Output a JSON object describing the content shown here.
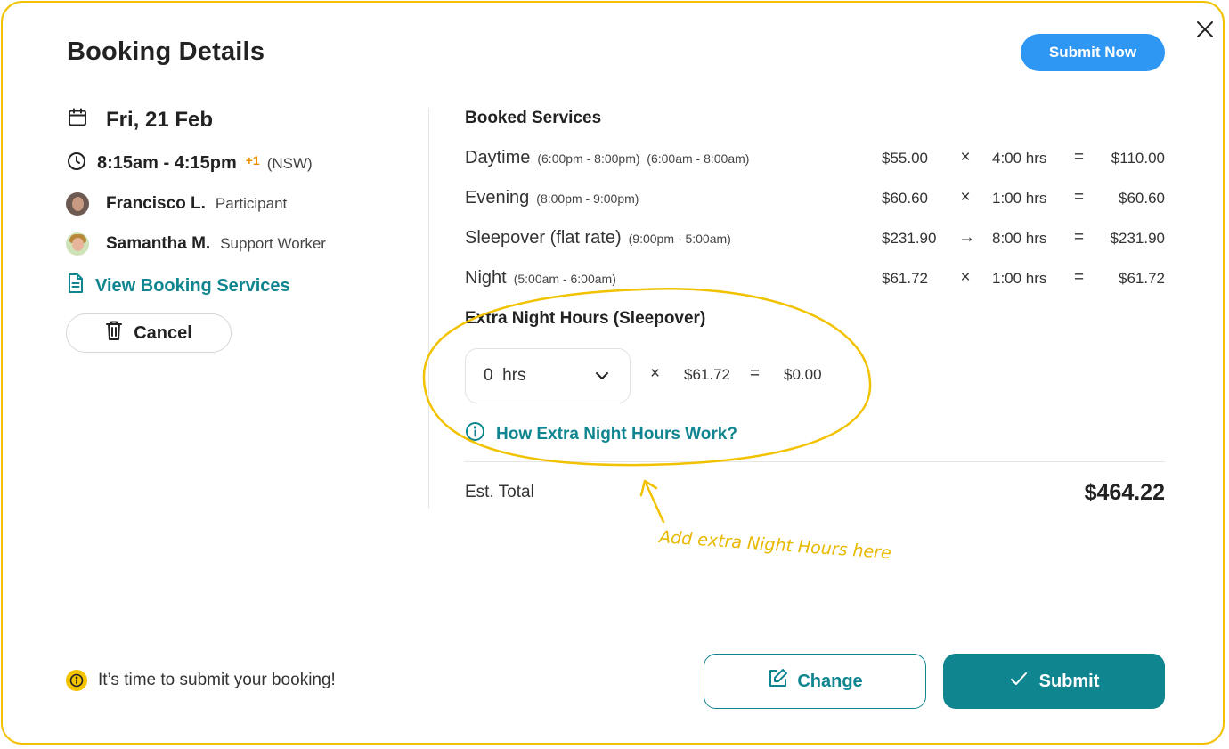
{
  "dialog": {
    "title": "Booking Details",
    "submit_now_label": "Submit Now",
    "close_icon": "close-icon"
  },
  "booking": {
    "date": "Fri, 21 Feb",
    "time": "8:15am - 4:15pm",
    "day_offset": "+1",
    "timezone": "(NSW)",
    "people": [
      {
        "name": "Francisco L.",
        "role": "Participant"
      },
      {
        "name": "Samantha M.",
        "role": "Support Worker"
      }
    ],
    "view_services_label": "View Booking Services",
    "cancel_label": "Cancel"
  },
  "services": {
    "title": "Booked Services",
    "items": [
      {
        "name": "Daytime",
        "ranges": "(6:00pm - 8:00pm)  (6:00am - 8:00am)",
        "rate": "$55.00",
        "op": "×",
        "hours": "4:00 hrs",
        "eq": "=",
        "amount": "$110.00"
      },
      {
        "name": "Evening",
        "ranges": "(8:00pm - 9:00pm)",
        "rate": "$60.60",
        "op": "×",
        "hours": "1:00 hrs",
        "eq": "=",
        "amount": "$60.60"
      },
      {
        "name": "Sleepover (flat rate)",
        "ranges": "(9:00pm - 5:00am)",
        "rate": "$231.90",
        "op": "→",
        "hours": "8:00 hrs",
        "eq": "=",
        "amount": "$231.90"
      },
      {
        "name": "Night",
        "ranges": "(5:00am - 6:00am)",
        "rate": "$61.72",
        "op": "×",
        "hours": "1:00 hrs",
        "eq": "=",
        "amount": "$61.72"
      }
    ],
    "extra": {
      "title": "Extra Night Hours (Sleepover)",
      "selected": "0  hrs",
      "op": "×",
      "rate": "$61.72",
      "eq": "=",
      "amount": "$0.00",
      "help_label": "How Extra Night Hours Work?"
    },
    "est_label": "Est. Total",
    "est_total": "$464.22"
  },
  "annotation": {
    "text": "Add extra Night Hours here",
    "color": "#f2c200"
  },
  "footer": {
    "message": "It’s time to submit your booking!",
    "change_label": "Change",
    "submit_label": "Submit"
  },
  "colors": {
    "accent": "#0f8590",
    "primary_blue": "#2e97f3",
    "warning": "#f08c00",
    "highlight": "#f2c200"
  }
}
